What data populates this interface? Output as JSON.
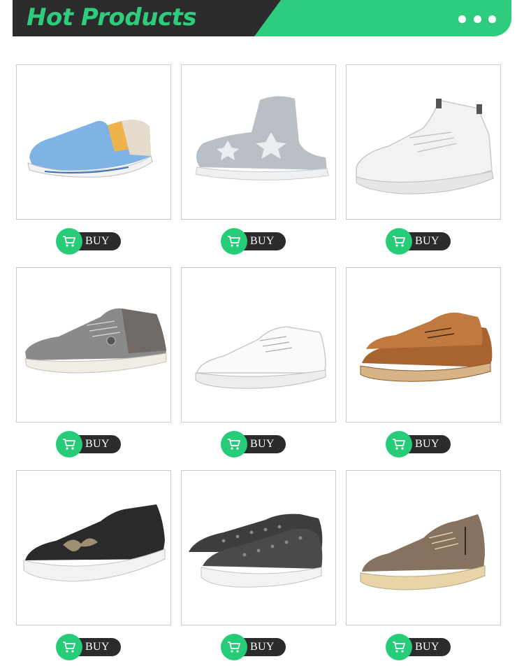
{
  "header": {
    "title": "Hot Products",
    "more_icon": "more-dots-icon",
    "colors": {
      "dark": "#2b2b2b",
      "accent": "#2ecc7d"
    }
  },
  "products": [
    {
      "name": "blue-canvas-slip-on",
      "image_icon": "shoe-blue-slip-on",
      "buy_label": "BUY",
      "cart_icon": "cart-icon"
    },
    {
      "name": "grey-star-sock-sneaker",
      "image_icon": "shoe-grey-sock",
      "buy_label": "BUY",
      "cart_icon": "cart-icon"
    },
    {
      "name": "white-knit-runner",
      "image_icon": "shoe-white-knit",
      "buy_label": "BUY",
      "cart_icon": "cart-icon"
    },
    {
      "name": "grey-mesh-sneaker",
      "image_icon": "shoe-grey-mesh",
      "buy_label": "BUY",
      "cart_icon": "cart-icon"
    },
    {
      "name": "white-leather-sneaker",
      "image_icon": "shoe-white-leather",
      "buy_label": "BUY",
      "cart_icon": "cart-icon"
    },
    {
      "name": "brown-leather-lace-up",
      "image_icon": "shoe-brown-leather",
      "buy_label": "BUY",
      "cart_icon": "cart-icon"
    },
    {
      "name": "black-butterfly-slip-on",
      "image_icon": "shoe-black-butterfly",
      "buy_label": "BUY",
      "cart_icon": "cart-icon"
    },
    {
      "name": "sequin-black-slip-on",
      "image_icon": "shoe-black-sequin",
      "buy_label": "BUY",
      "cart_icon": "cart-icon"
    },
    {
      "name": "taupe-suede-zip-sneaker",
      "image_icon": "shoe-taupe-suede",
      "buy_label": "BUY",
      "cart_icon": "cart-icon"
    }
  ]
}
